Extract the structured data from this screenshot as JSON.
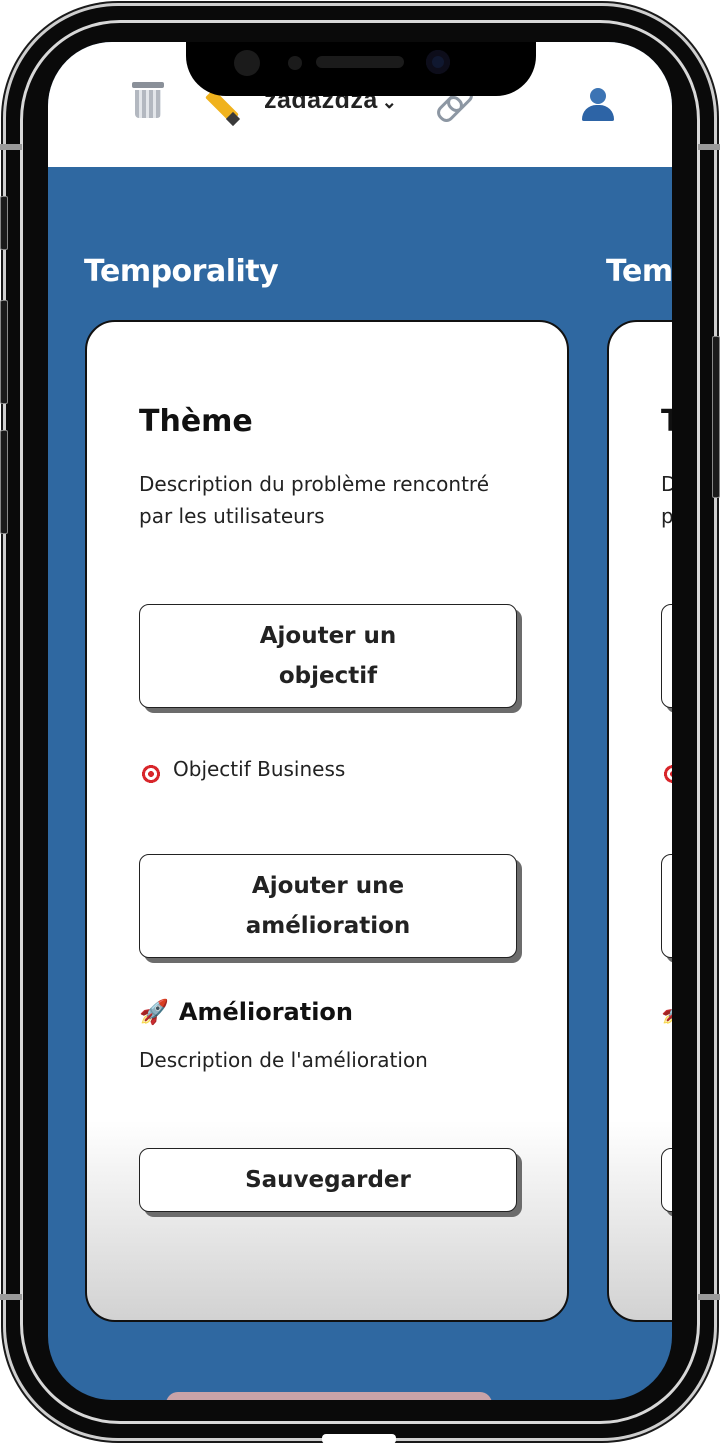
{
  "header": {
    "board_name": "zadazdza",
    "chevron": "⌄",
    "icons": [
      "trash-icon",
      "pencil-icon",
      "link-icon",
      "user-icon"
    ]
  },
  "columns": [
    {
      "title": "Temporality",
      "card": {
        "heading": "Thème",
        "description": "Description du problème rencontré par les utilisateurs",
        "add_objective_label": "Ajouter un objectif",
        "objective_label": "Objectif Business",
        "add_improvement_label": "Ajouter une amélioration",
        "improvement_heading": "Amélioration",
        "improvement_description": "Description de l'amélioration",
        "save_label": "Sauvegarder"
      }
    },
    {
      "title": "Temporality",
      "card": {
        "heading": "Thème",
        "description": "Description du problème rencontré par les utilisateurs"
      }
    }
  ],
  "colors": {
    "background": "#2f68a1",
    "card": "#ffffff",
    "text": "#222222"
  }
}
